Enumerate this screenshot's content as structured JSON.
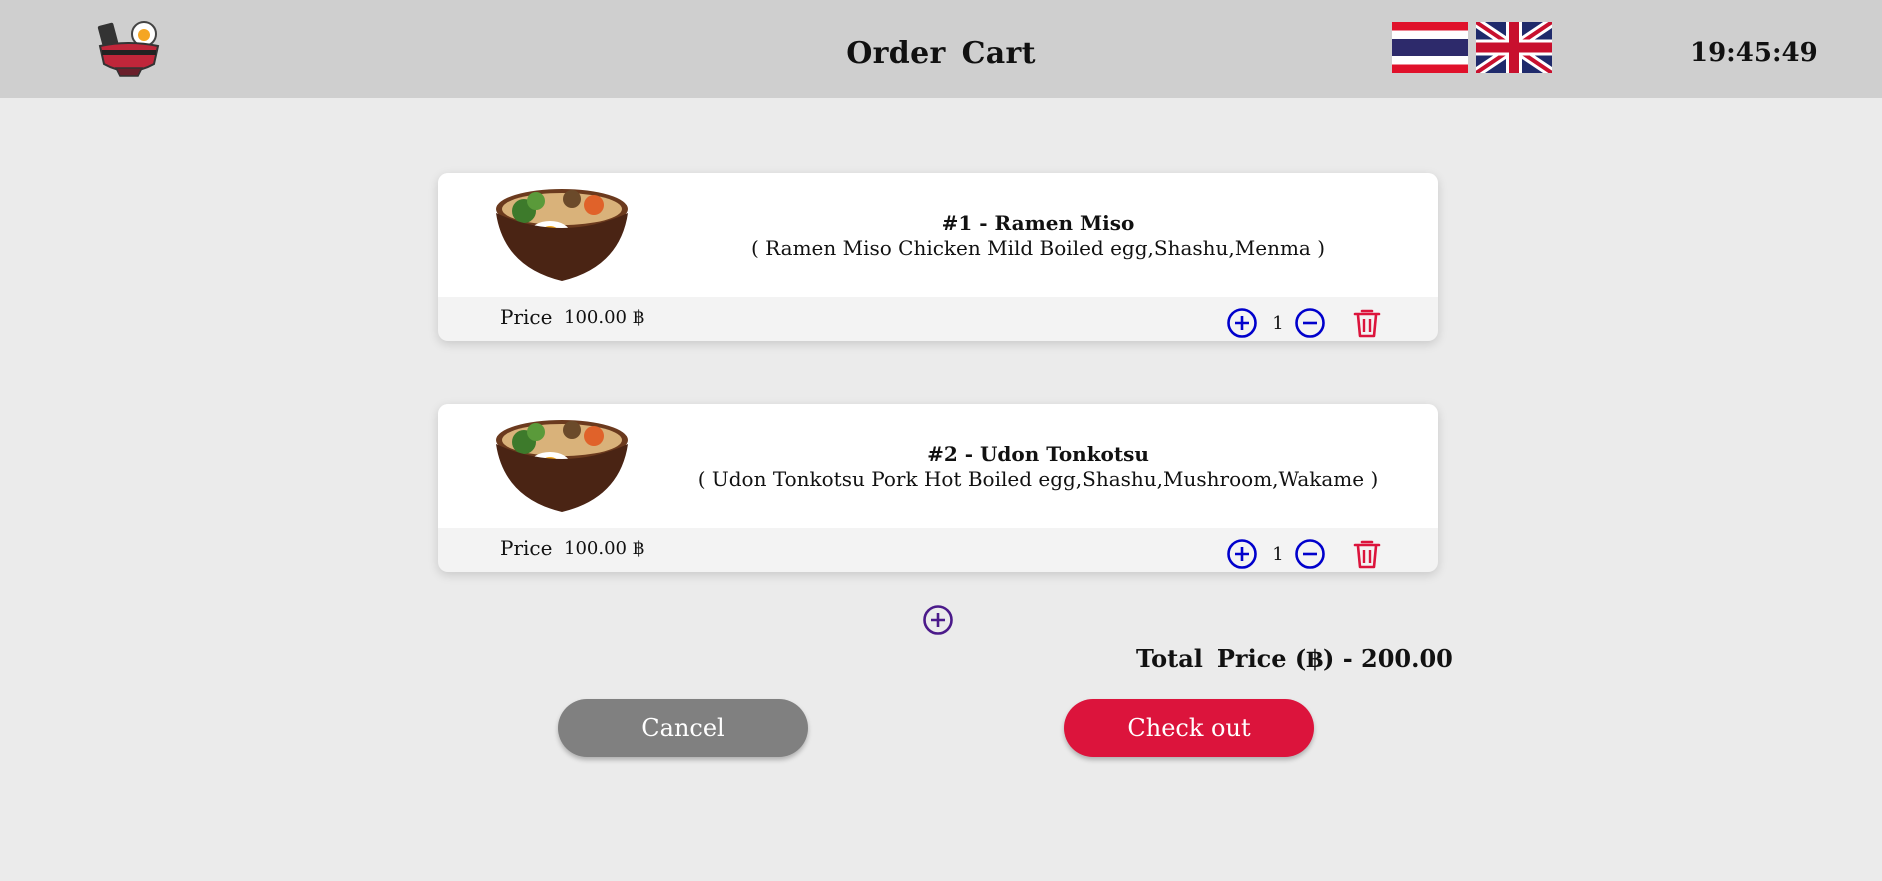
{
  "header": {
    "title_word1": "Order",
    "title_word2": "Cart",
    "clock": "19:45:49",
    "flags": [
      "thai-flag-icon",
      "uk-flag-icon"
    ]
  },
  "cart": {
    "items": [
      {
        "name": "#1 - Ramen Miso",
        "description": "( Ramen Miso Chicken Mild Boiled egg,Shashu,Menma )",
        "price_label": "Price",
        "price": "100.00 ฿",
        "quantity": "1"
      },
      {
        "name": "#2 - Udon Tonkotsu",
        "description": "( Udon Tonkotsu Pork Hot Boiled egg,Shashu,Mushroom,Wakame )",
        "price_label": "Price",
        "price": "100.00 ฿",
        "quantity": "1"
      }
    ],
    "total_label": "Total",
    "total_price": "Price (฿) - 200.00"
  },
  "buttons": {
    "cancel": "Cancel",
    "checkout": "Check out"
  },
  "colors": {
    "header_bg": "#cfcfcf",
    "page_bg": "#ebebeb",
    "accent_red": "#dc143c",
    "icon_blue": "#0000cc",
    "cancel_gray": "#808080"
  }
}
